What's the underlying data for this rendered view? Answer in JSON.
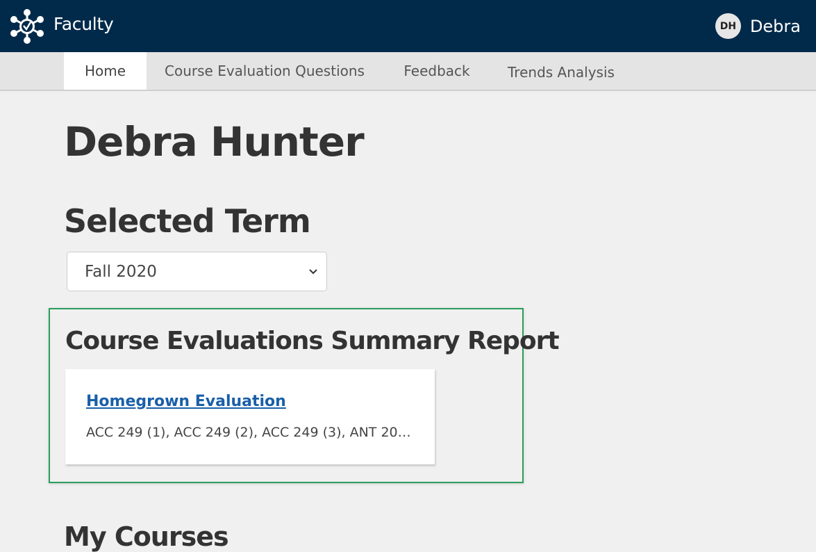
{
  "header": {
    "app_title": "Faculty",
    "logo_icon": "network-check-logo-icon",
    "user": {
      "initials": "DH",
      "name": "Debra"
    }
  },
  "nav": {
    "tabs": [
      {
        "label": "Home",
        "active": true
      },
      {
        "label": "Course Evaluation Questions",
        "active": false
      },
      {
        "label": "Feedback",
        "active": false
      },
      {
        "label": "Trends Analysis",
        "active": false
      }
    ]
  },
  "main": {
    "page_title": "Debra Hunter",
    "selected_term_heading": "Selected Term",
    "term_select": {
      "value": "Fall 2020",
      "icon": "chevron-down-icon"
    },
    "summary_report": {
      "heading": "Course Evaluations Summary Report",
      "highlight_color": "#2a9d5c",
      "card": {
        "link_label": "Homegrown Evaluation",
        "courses": "ACC 249 (1), ACC 249 (2), ACC 249 (3), ANT 201..."
      }
    },
    "my_courses_heading": "My Courses"
  },
  "colors": {
    "header_bg": "#012a4a",
    "link": "#1a5fa8"
  }
}
